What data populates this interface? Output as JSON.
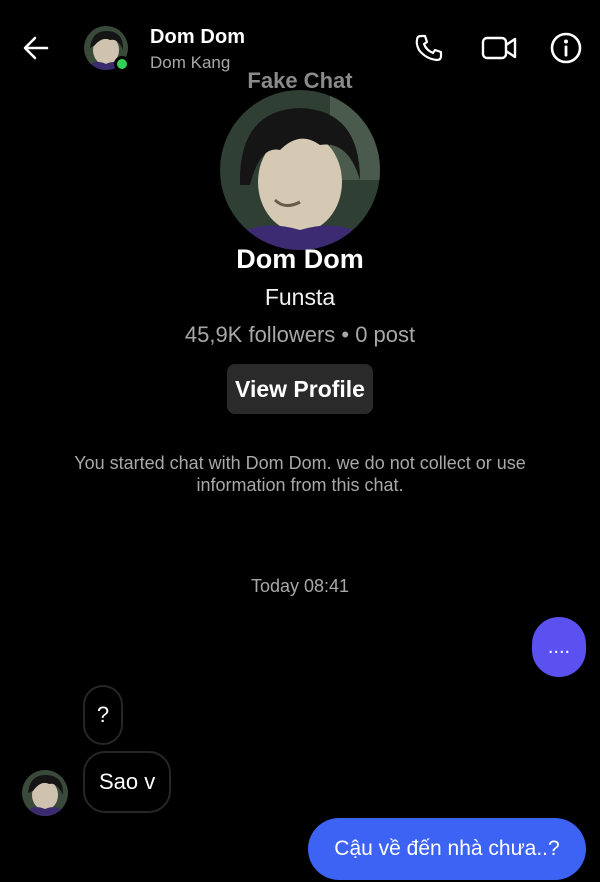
{
  "header": {
    "name": "Dom Dom",
    "username": "Dom Kang",
    "icons": [
      "back-arrow-icon",
      "phone-icon",
      "video-icon",
      "info-icon"
    ],
    "online_color": "#31d158"
  },
  "profile": {
    "watermark": "Fake Chat",
    "name": "Dom Dom",
    "subtitle": "Funsta",
    "stats": "45,9K followers • 0 post",
    "view_profile_label": "View Profile",
    "notice": "You started chat with Dom Dom. we do not collect or use information from this chat."
  },
  "chat": {
    "timestamp": "Today 08:41",
    "messages": [
      {
        "from": "me",
        "text": "....",
        "color": "#5b51f0"
      },
      {
        "from": "them",
        "text": "?"
      },
      {
        "from": "them",
        "text": "Sao v"
      },
      {
        "from": "me",
        "text": "Cậu về đến nhà chưa..?",
        "color": "#3d63f5"
      }
    ]
  }
}
